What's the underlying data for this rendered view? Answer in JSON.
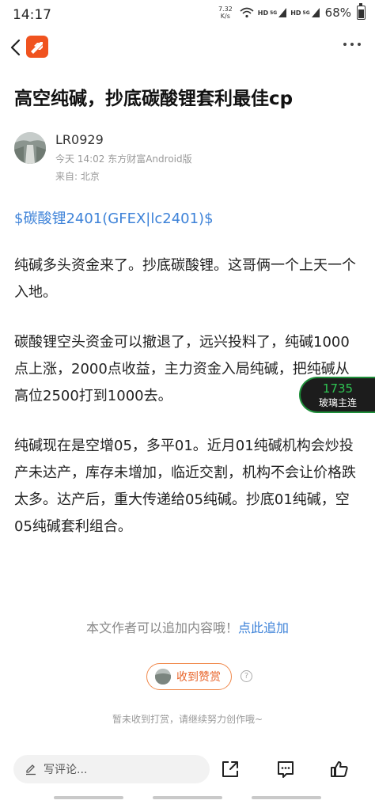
{
  "status_bar": {
    "time": "14:17",
    "net_speed_value": "7.32",
    "net_speed_unit": "K/s",
    "hd1": "HD",
    "sig1": "5G",
    "hd2": "HD",
    "sig2": "5G",
    "battery_percent": "68%",
    "battery_level": 0.68
  },
  "nav": {
    "back_icon": "chevron-left-icon",
    "logo_icon": "app-logo",
    "more_icon": "more-horizontal-icon"
  },
  "article": {
    "title": "高空纯碱，抄底碳酸锂套利最佳cp",
    "author": "LR0929",
    "meta": "今天 14:02 东方财富Android版",
    "location": "来自: 北京",
    "stock_link": "$碳酸锂2401(GFEX|lc2401)$",
    "paragraphs": [
      "纯碱多头资金来了。抄底碳酸锂。这哥俩一个上天一个入地。",
      "碳酸锂空头资金可以撤退了，远兴投料了，纯碱1000点上涨，2000点收益，主力资金入局纯碱，把纯碱从高位2500打到1000去。",
      "纯碱现在是空增05，多平01。近月01纯碱机构会炒投产未达产，库存未增加，临近交割，机构不会让价格跌太多。达产后，重大传递给05纯碱。抄底01纯碱，空05纯碱套利组合。"
    ]
  },
  "ticker": {
    "value": "1735",
    "name": "玻璃主连",
    "color": "#2fc453"
  },
  "footer": {
    "add_text": "本文作者可以追加内容哦！",
    "add_link": "点此追加",
    "reward_label": "收到赞赏",
    "help_icon": "?",
    "reward_note": "暂未收到打赏，请继续努力创作哦~"
  },
  "bottom_bar": {
    "comment_placeholder": "写评论...",
    "icons": [
      "edit-icon",
      "share-icon",
      "comment-icon",
      "like-icon"
    ]
  },
  "colors": {
    "link": "#3d82d8",
    "brand": "#f0531f",
    "reward_accent": "#e8642a"
  }
}
